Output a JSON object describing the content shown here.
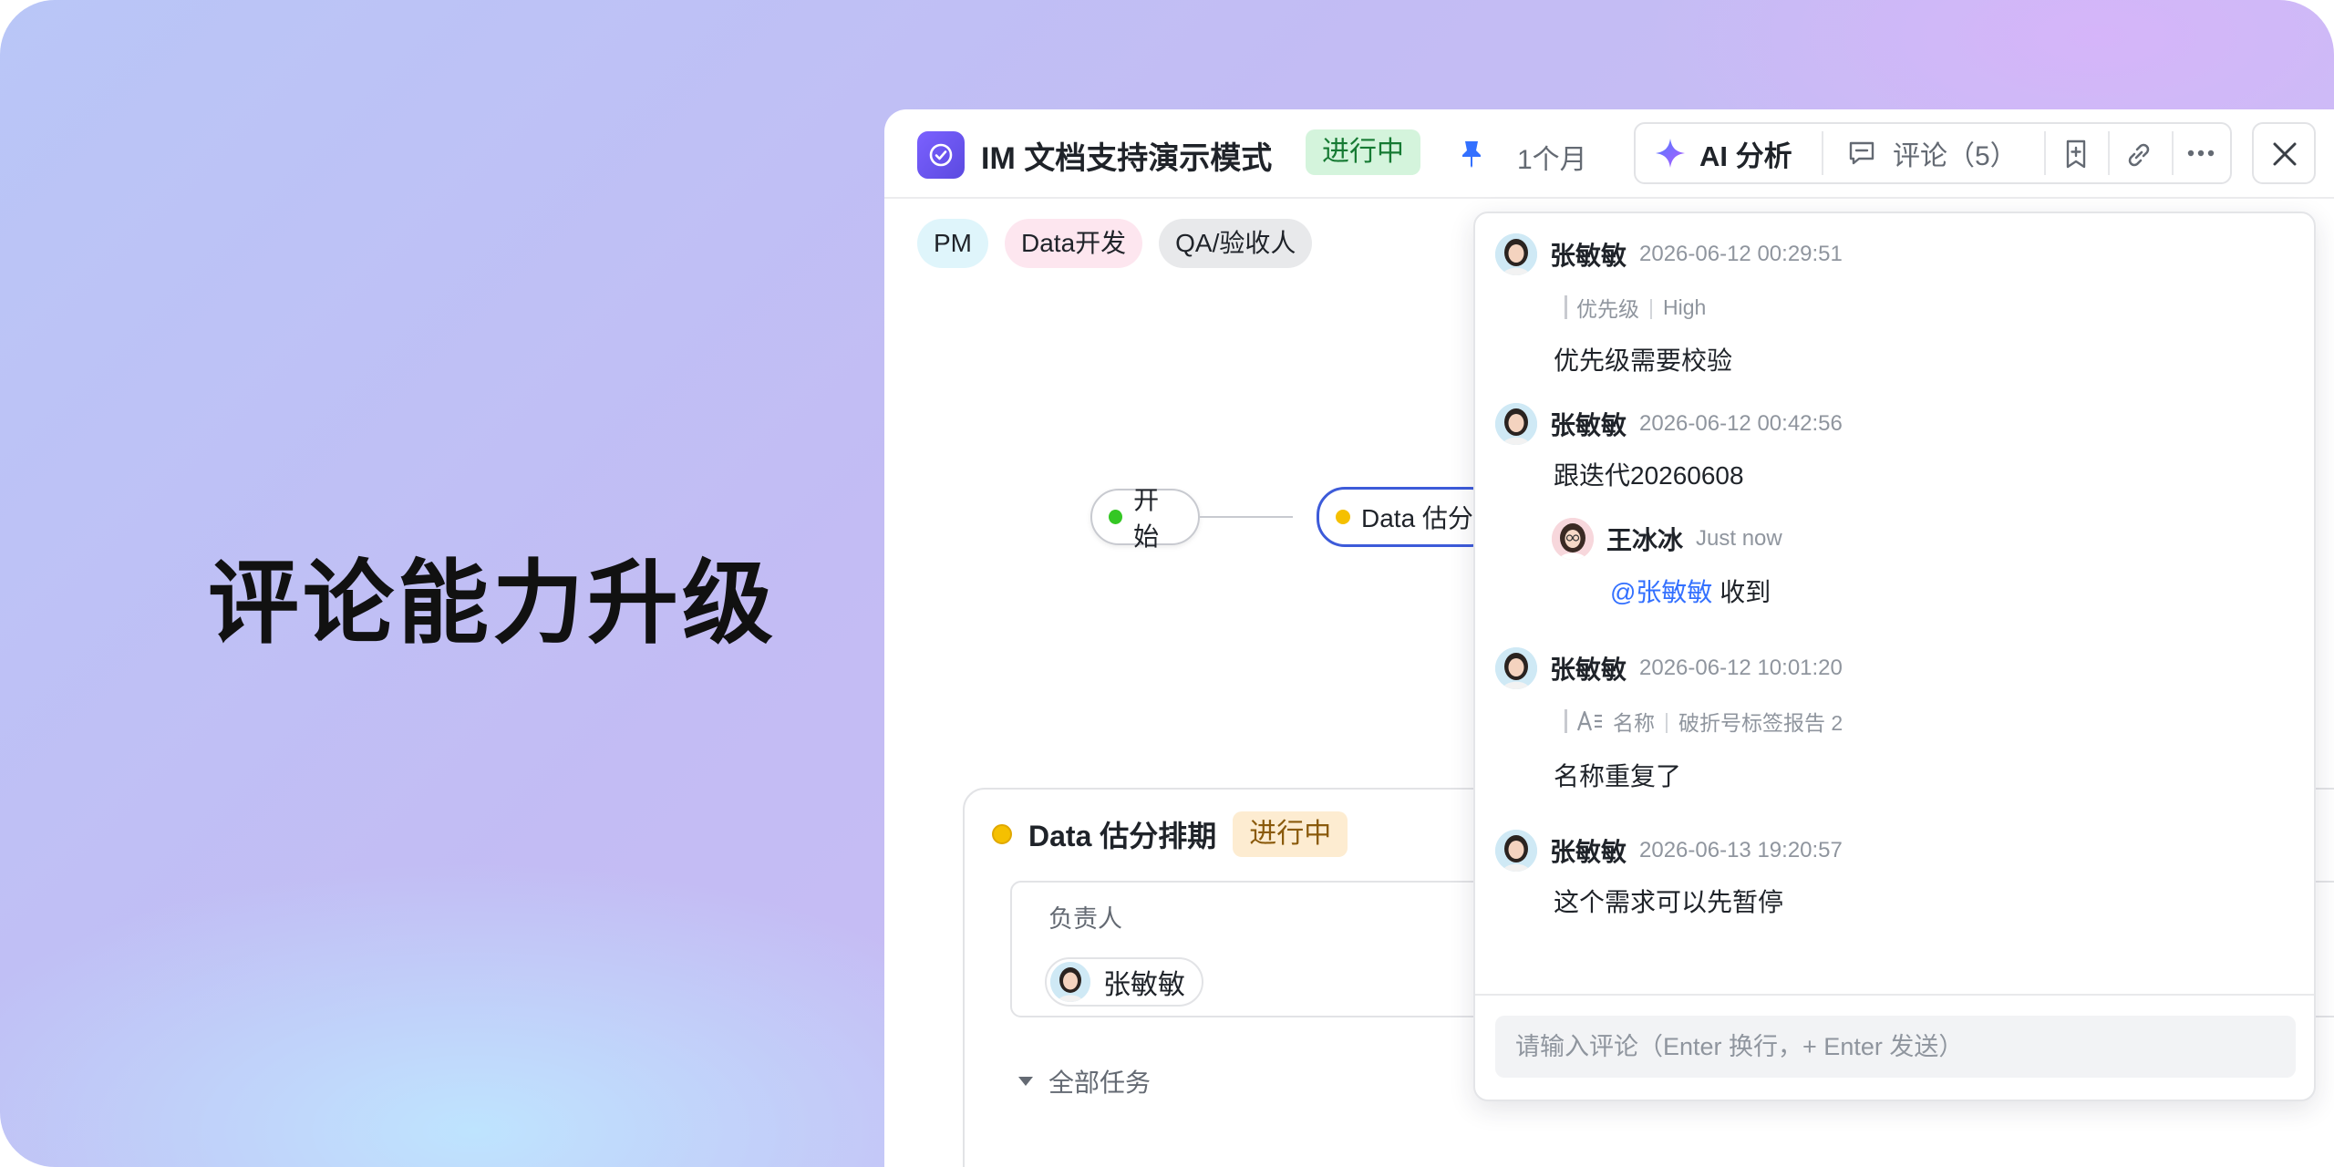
{
  "hero": {
    "title": "评论能力升级"
  },
  "window": {
    "title": "IM 文档支持演示模式",
    "status": "进行中",
    "time": "1个月",
    "toolbar": {
      "ai_label": "AI 分析",
      "comment_label": "评论（5）"
    },
    "tags": [
      "PM",
      "Data开发",
      "QA/验收人"
    ],
    "flow": {
      "start": "开始",
      "node2": "Data 估分"
    },
    "task": {
      "title": "Data 估分排期",
      "status": "进行中",
      "owner_label": "负责人",
      "owner_name": "张敏敏",
      "all_tasks": "全部任务"
    }
  },
  "comments": {
    "c1": {
      "name": "张敏敏",
      "time": "2026-06-12  00:29:51",
      "quote_field": "优先级",
      "quote_value": "High",
      "body": "优先级需要校验"
    },
    "c2": {
      "name": "张敏敏",
      "time": "2026-06-12  00:42:56",
      "body": "跟迭代20260608"
    },
    "reply": {
      "name": "王冰冰",
      "time": "Just now",
      "mention": "@张敏敏",
      "body": " 收到"
    },
    "c3": {
      "name": "张敏敏",
      "time": "2026-06-12 10:01:20",
      "quote_field": "名称",
      "quote_value": "破折号标签报告 2",
      "body": "名称重复了"
    },
    "c4": {
      "name": "张敏敏",
      "time": "2026-06-13 19:20:57",
      "body": "这个需求可以先暂停"
    },
    "input_placeholder": "请输入评论（Enter 换行，+ Enter 发送）"
  },
  "colors": {
    "accent": "#3370ff",
    "app_icon": "#6c55f2",
    "status_green_bg": "#d4f4dc",
    "status_green_fg": "#167a33",
    "status_orange_bg": "#fdecd1",
    "status_orange_fg": "#8a5a0b",
    "pin": "#3370ff"
  }
}
